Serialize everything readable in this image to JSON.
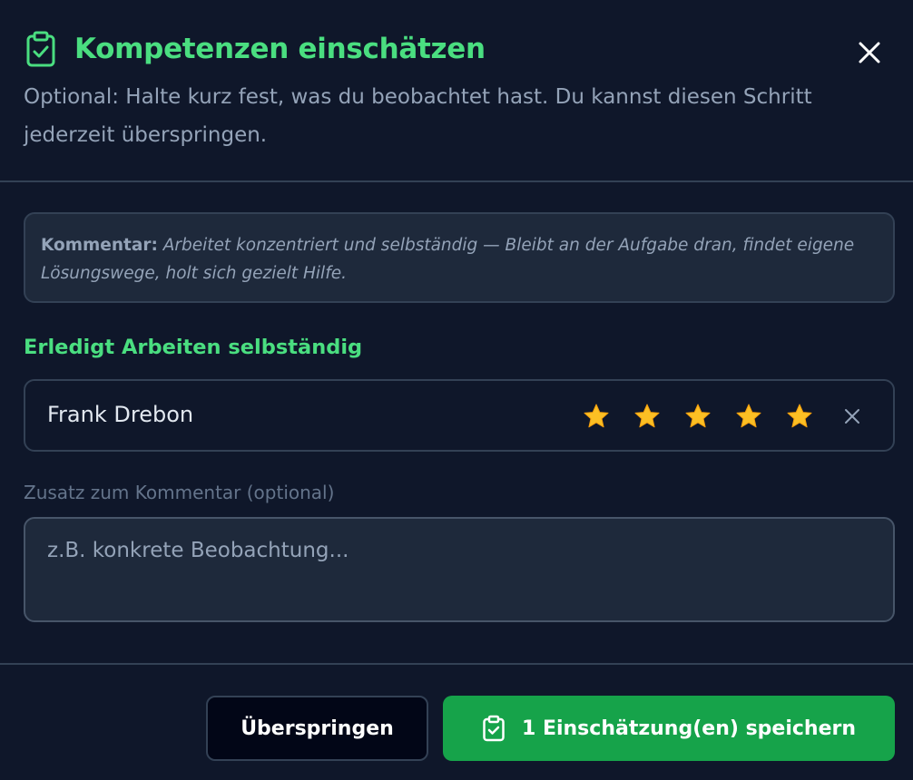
{
  "dialog": {
    "title": "Kompetenzen einschätzen",
    "title_icon": "clipboard-check-icon",
    "subtitle": "Optional: Halte kurz fest, was du beobachtet hast. Du kannst diesen Schritt jederzeit überspringen.",
    "close_icon": "close-icon"
  },
  "comment": {
    "label": "Kommentar:",
    "text": "Arbeitet konzentriert und selbständig — Bleibt an der Aufgabe dran, findet eigene Lösungswege, holt sich gezielt Hilfe."
  },
  "competency": {
    "heading": "Erledigt Arbeiten selbständig",
    "student_name": "Frank Drebon",
    "rating": 5,
    "rating_max": 5,
    "star_icon": "star-icon",
    "clear_icon": "clear-rating-icon"
  },
  "addition": {
    "label": "Zusatz zum Kommentar (optional)",
    "placeholder": "z.B. konkrete Beobachtung...",
    "value": ""
  },
  "footer": {
    "skip_label": "Überspringen",
    "save_label": "1 Einschätzung(en) speichern",
    "save_icon": "clipboard-check-icon"
  },
  "colors": {
    "background": "#0f172a",
    "accent_green": "#4ade80",
    "button_green": "#16a34a",
    "star": "#fbbf24",
    "border": "#334155",
    "muted_text": "#94a3b8"
  }
}
